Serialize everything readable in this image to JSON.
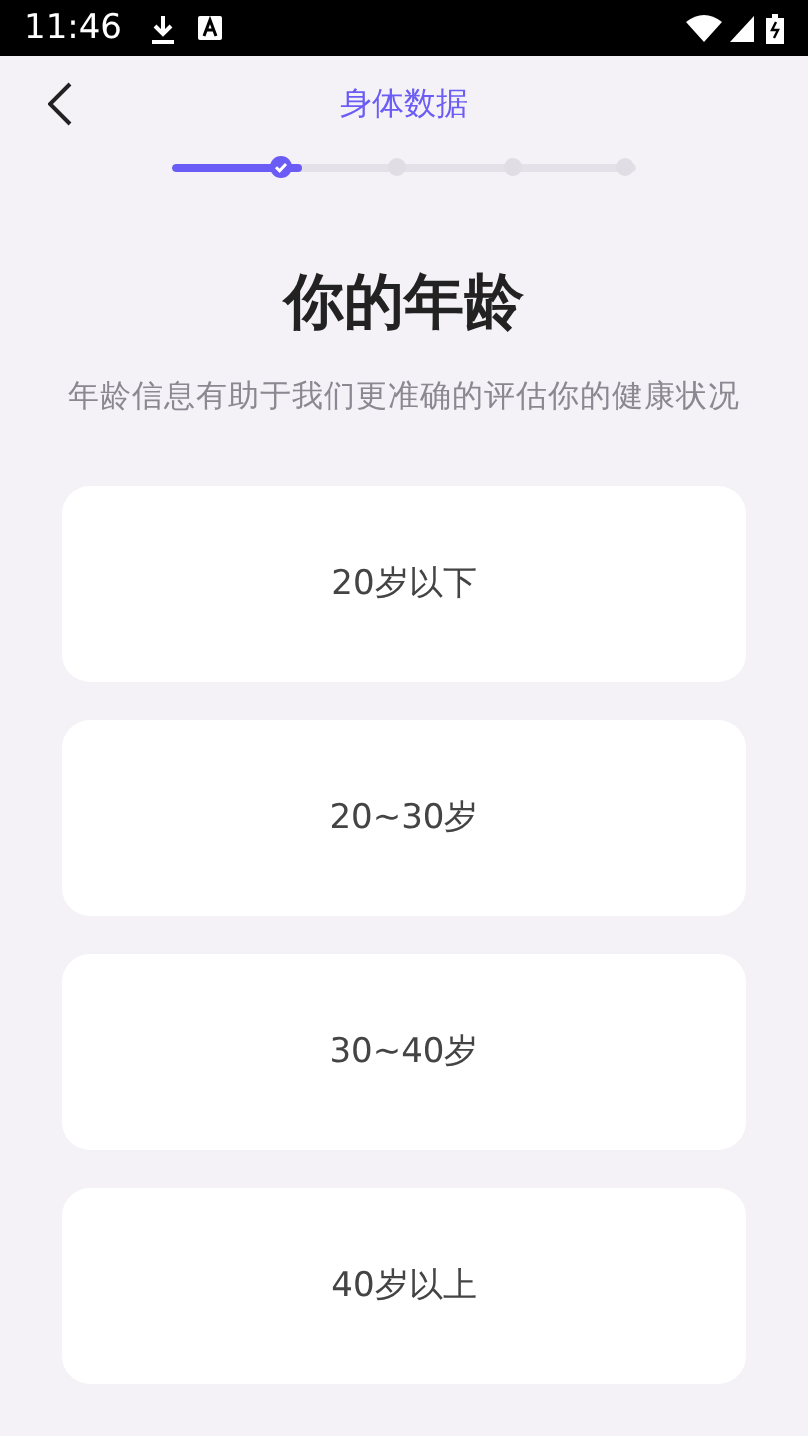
{
  "status_bar": {
    "time": "11:46"
  },
  "header": {
    "title": "身体数据"
  },
  "progress": {
    "level": 0.28
  },
  "steps": [
    {
      "done": true
    },
    {
      "done": false
    },
    {
      "done": false
    },
    {
      "done": false
    }
  ],
  "question": {
    "title": "你的年龄",
    "subtitle": "年龄信息有助于我们更准确的评估你的健康状况"
  },
  "options": [
    {
      "label": "20岁以下",
      "selected": false
    },
    {
      "label": "20~30岁",
      "selected": false
    },
    {
      "label": "30~40岁",
      "selected": false
    },
    {
      "label": "40岁以上",
      "selected": false
    }
  ]
}
